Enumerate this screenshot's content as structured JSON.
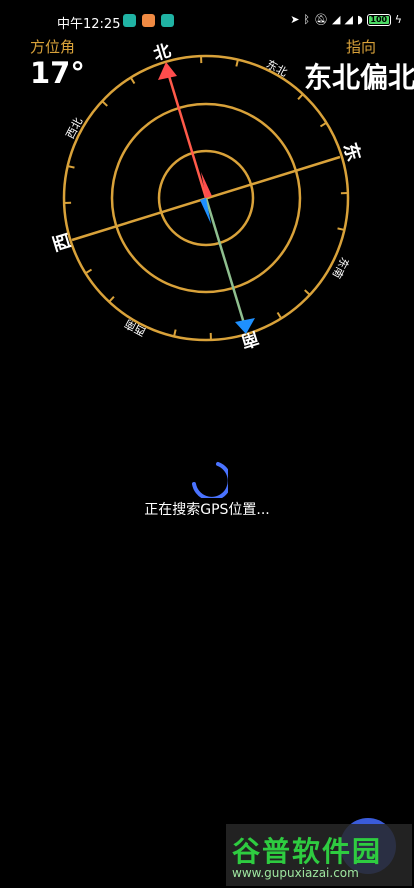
{
  "status_bar": {
    "time": "中午12:25",
    "battery": "100",
    "app_icon_colors": [
      "#20b3a4",
      "#f08a43",
      "#20b3a4"
    ],
    "battery_color": "#4cd964"
  },
  "header": {
    "azimuth_label": "方位角",
    "azimuth_value": "17°",
    "direction_label": "指向",
    "direction_value": "东北偏北"
  },
  "compass": {
    "labels": {
      "north": "北",
      "northeast": "东北",
      "east": "东",
      "southeast": "东南",
      "south": "南",
      "southwest": "西南",
      "west": "西",
      "northwest": "西北"
    },
    "ring_color": "#d9a23a",
    "north_arrow_color": "#ff4d4d",
    "south_arrow_color": "#1e90ff"
  },
  "status": {
    "search_text": "正在搜索GPS位置..."
  },
  "watermark": {
    "title": "谷普软件园",
    "url": "www.gupuxiazai.com"
  }
}
